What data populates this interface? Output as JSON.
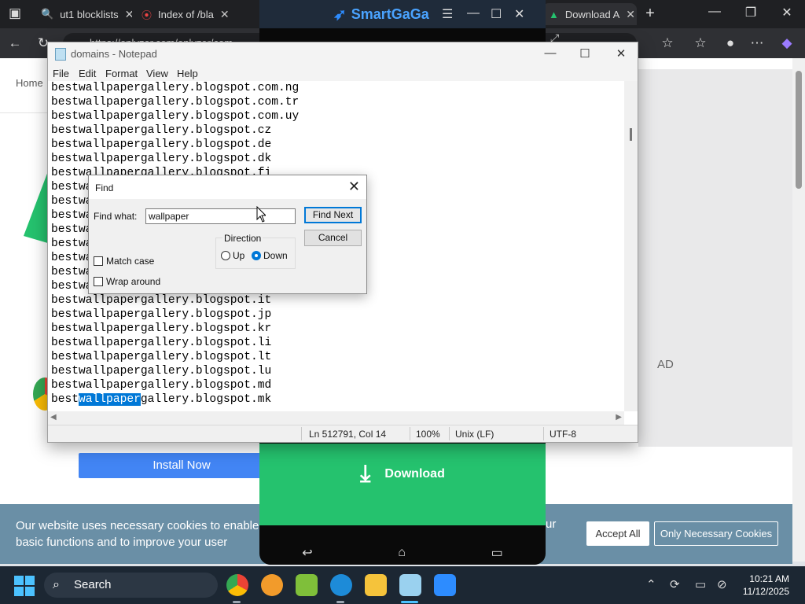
{
  "browser": {
    "tabs": [
      {
        "label": "ut1 blocklists",
        "active": false
      },
      {
        "label": "Index of /bla",
        "active": false
      },
      {
        "label": "Download A",
        "active": true
      }
    ],
    "url": "https://enlyzer.com/enlyzer/com..."
  },
  "emulator": {
    "title": "SmartGaGa",
    "download_label": "Download"
  },
  "page": {
    "breadcrumb": "Home",
    "ad_label": "AD",
    "install_label": "Install Now",
    "cookie_text": "Our website uses necessary cookies to enable basic functions and to improve your user experience. Learn more about our cookie policy",
    "cookie_tail": "ur",
    "accept_all": "Accept All",
    "only_necessary": "Only Necessary Cookies"
  },
  "notepad": {
    "title": "domains - Notepad",
    "menu": [
      "File",
      "Edit",
      "Format",
      "View",
      "Help"
    ],
    "lines_top": [
      "bestwallpapergallery.blogspot.com.ng",
      "bestwallpapergallery.blogspot.com.tr",
      "bestwallpapergallery.blogspot.com.uy",
      "bestwallpapergallery.blogspot.cz",
      "bestwallpapergallery.blogspot.de",
      "bestwallpapergallery.blogspot.dk",
      "bestwallpapergallery.blogspot.fi",
      "bestwa",
      "bestwa",
      "bestwa",
      "bestwa",
      "bestwa",
      "bestwa",
      "bestwa",
      "bestwa"
    ],
    "lines_bottom": [
      "bestwallpapergallery.blogspot.it",
      "bestwallpapergallery.blogspot.jp",
      "bestwallpapergallery.blogspot.kr",
      "bestwallpapergallery.blogspot.li",
      "bestwallpapergallery.blogspot.lt",
      "bestwallpapergallery.blogspot.lu",
      "bestwallpapergallery.blogspot.md"
    ],
    "highlight_line": {
      "before": "best",
      "match": "wallpaper",
      "after": "gallery.blogspot.mk"
    },
    "status": {
      "position": "Ln 512791, Col 14",
      "zoom": "100%",
      "eol": "Unix (LF)",
      "encoding": "UTF-8"
    }
  },
  "find_dialog": {
    "title": "Find",
    "find_what_label": "Find what:",
    "find_what_value": "wallpaper",
    "find_next": "Find Next",
    "cancel": "Cancel",
    "direction_label": "Direction",
    "up_label": "Up",
    "down_label": "Down",
    "direction_selected": "Down",
    "match_case_label": "Match case",
    "match_case": false,
    "wrap_around_label": "Wrap around",
    "wrap_around": false
  },
  "taskbar": {
    "search_label": "Search",
    "time": "10:21 AM",
    "date": "11/12/2025"
  }
}
